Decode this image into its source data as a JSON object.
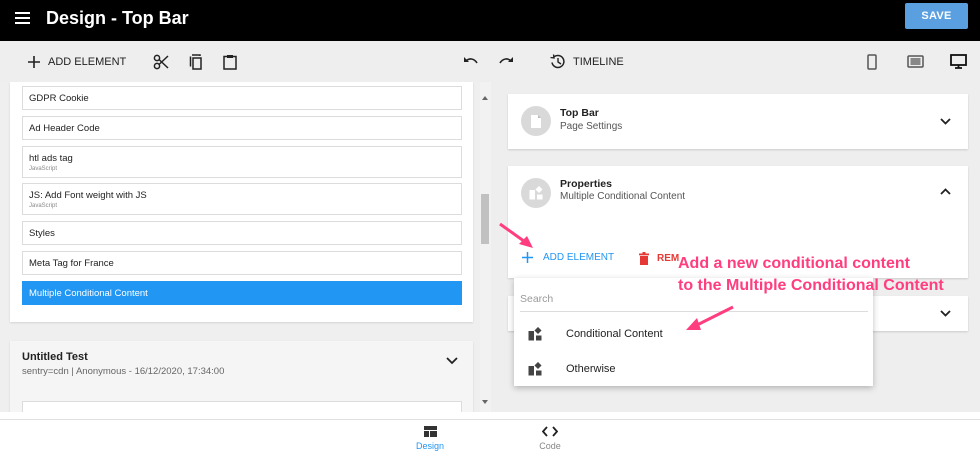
{
  "header": {
    "title": "Design - Top Bar",
    "save_label": "SAVE"
  },
  "toolbar": {
    "add_element_label": "ADD ELEMENT",
    "timeline_label": "TIMELINE"
  },
  "scripts_list": [
    {
      "name": "GDPR Cookie",
      "sub": ""
    },
    {
      "name": "Ad Header Code",
      "sub": ""
    },
    {
      "name": "htl ads tag",
      "sub": "JavaScript"
    },
    {
      "name": "JS: Add Font weight with JS",
      "sub": "JavaScript"
    },
    {
      "name": "Styles",
      "sub": ""
    },
    {
      "name": "Meta Tag for France",
      "sub": ""
    },
    {
      "name": "Multiple Conditional Content",
      "sub": ""
    }
  ],
  "test_card": {
    "title": "Untitled Test",
    "subtitle": "sentry=cdn | Anonymous - 16/12/2020, 17:34:00"
  },
  "sections": {
    "top_bar": {
      "title": "Top Bar",
      "subtitle": "Page Settings"
    },
    "properties": {
      "title": "Properties",
      "subtitle": "Multiple Conditional Content"
    }
  },
  "properties_actions": {
    "add_element": "ADD ELEMENT",
    "remove": "REM"
  },
  "dropdown": {
    "search_placeholder": "Search",
    "items": [
      "Conditional Content",
      "Otherwise"
    ]
  },
  "annotation": {
    "line1": "Add a new conditional content",
    "line2": "to the Multiple Conditional Content",
    "color": "#ff3d7f"
  },
  "bottom_nav": {
    "design_label": "Design",
    "code_label": "Code"
  },
  "colors": {
    "accent": "#2196f3",
    "danger": "#e53935",
    "save": "#5aa0e0"
  }
}
